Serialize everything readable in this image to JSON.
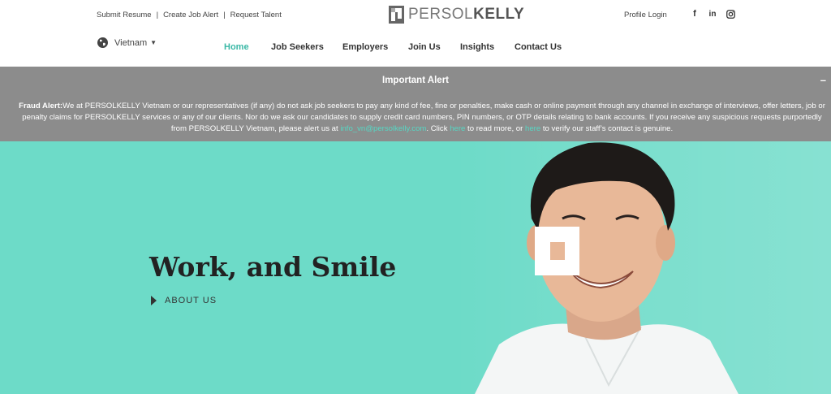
{
  "header": {
    "top_links": [
      "Submit Resume",
      "Create Job Alert",
      "Request Talent"
    ],
    "logo": {
      "prefix": "PERSOL",
      "suffix": "KELLY"
    },
    "profile_login": "Profile Login",
    "social_icons": [
      "facebook-icon",
      "linkedin-icon",
      "instagram-icon"
    ],
    "country": "Vietnam"
  },
  "nav": {
    "items": [
      "Home",
      "Job Seekers",
      "Employers",
      "Join Us",
      "Insights",
      "Contact Us"
    ],
    "active": "Home"
  },
  "alert": {
    "title": "Important Alert",
    "collapse": "–",
    "label": "Fraud Alert:",
    "text_1": "We at PERSOLKELLY Vietnam or our representatives (if any) do not ask job seekers to pay any kind of fee, fine or penalties, make cash or online payment through any channel in exchange of interviews, offer letters, job or penalty claims for PERSOLKELLY services or any of our clients. Nor do we ask our candidates to supply credit card numbers, PIN numbers, or OTP details relating to bank accounts. If you receive any suspicious requests purportedly from PERSOLKELLY Vietnam, please alert us at ",
    "email": "info_vn@persolkelly.com",
    "text_2": ". Click ",
    "link_1": "here",
    "text_3": " to read more, or ",
    "link_2": "here",
    "text_4": " to verify our staff’s contact is genuine."
  },
  "hero": {
    "title": "Work, and Smile",
    "cta": "ABOUT US"
  },
  "colors": {
    "accent": "#3ab8a6",
    "hero_bg": "#6ddbc8",
    "alert_bg": "#8c8c8c",
    "alert_link": "#56d7c4"
  }
}
